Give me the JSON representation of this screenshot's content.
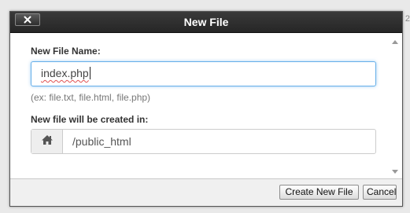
{
  "background": {
    "corner_text": "2"
  },
  "dialog": {
    "title": "New File",
    "close_label": "×",
    "file_name_label": "New File Name:",
    "file_name_value": "index.php",
    "file_name_hint": "(ex: file.txt, file.html, file.php)",
    "location_label": "New file will be created in:",
    "location_value": "/public_html",
    "location_icon": "home-icon"
  },
  "footer": {
    "create_label": "Create New File",
    "cancel_label": "Cancel"
  },
  "colors": {
    "titlebar": "#2e2e2e",
    "focus_border": "#66afe9",
    "addon_bg": "#eeeeee"
  }
}
